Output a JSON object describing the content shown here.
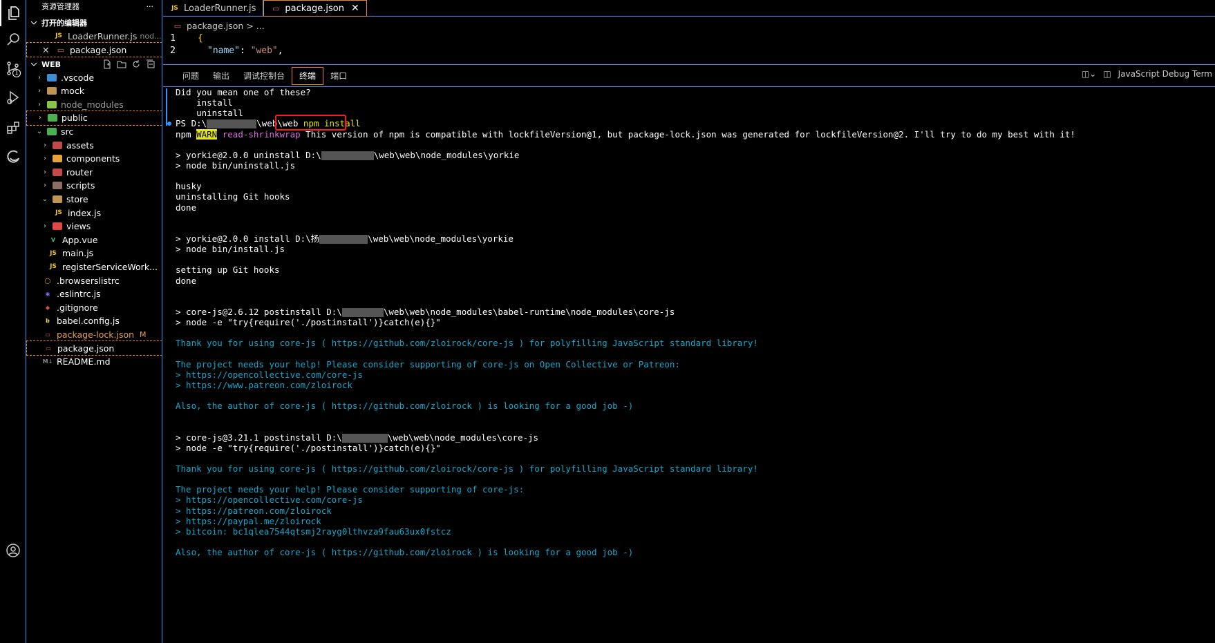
{
  "activity_bar": {
    "items": [
      {
        "name": "explorer-icon"
      },
      {
        "name": "search-icon"
      },
      {
        "name": "source-control-icon",
        "badge": "1"
      },
      {
        "name": "run-debug-icon"
      },
      {
        "name": "extensions-icon"
      },
      {
        "name": "edge-icon"
      },
      {
        "name": "account-icon"
      }
    ]
  },
  "sidebar": {
    "title": "资源管理器",
    "more": "···",
    "open_editors_label": "打开的编辑器",
    "open_editors": [
      {
        "label": "LoaderRunner.js",
        "desc": "nod..."
      },
      {
        "label": "package.json"
      }
    ],
    "workspace_label": "WEB",
    "tree": [
      {
        "label": ".vscode",
        "indent": 1,
        "kind": "folder",
        "color": "#3c8dd6",
        "open": false
      },
      {
        "label": "mock",
        "indent": 1,
        "kind": "folder",
        "color": "#c09553",
        "open": false
      },
      {
        "label": "node_modules",
        "indent": 1,
        "kind": "folder",
        "color": "#8bc34a",
        "open": false,
        "dim": true
      },
      {
        "label": "public",
        "indent": 1,
        "kind": "folder",
        "color": "#4caf50",
        "open": false,
        "selected": true
      },
      {
        "label": "src",
        "indent": 1,
        "kind": "folder",
        "color": "#4caf50",
        "open": true
      },
      {
        "label": "assets",
        "indent": 2,
        "kind": "folder",
        "color": "#c04a4a",
        "open": false
      },
      {
        "label": "components",
        "indent": 2,
        "kind": "folder",
        "color": "#e6a23c",
        "open": false
      },
      {
        "label": "router",
        "indent": 2,
        "kind": "folder",
        "color": "#c04a4a",
        "open": false
      },
      {
        "label": "scripts",
        "indent": 2,
        "kind": "folder",
        "color": "#8d6e63",
        "open": false
      },
      {
        "label": "store",
        "indent": 2,
        "kind": "folder",
        "color": "#c09553",
        "open": true
      },
      {
        "label": "index.js",
        "indent": 3,
        "kind": "js"
      },
      {
        "label": "views",
        "indent": 2,
        "kind": "folder",
        "color": "#e04848",
        "open": false
      },
      {
        "label": "App.vue",
        "indent": 2,
        "kind": "vue"
      },
      {
        "label": "main.js",
        "indent": 2,
        "kind": "js"
      },
      {
        "label": "registerServiceWork...",
        "indent": 2,
        "kind": "js"
      },
      {
        "label": ".browserslistrc",
        "indent": 1,
        "kind": "browserslist"
      },
      {
        "label": ".eslintrc.js",
        "indent": 1,
        "kind": "eslint"
      },
      {
        "label": ".gitignore",
        "indent": 1,
        "kind": "git"
      },
      {
        "label": "babel.config.js",
        "indent": 1,
        "kind": "babel"
      },
      {
        "label": "package-lock.json",
        "indent": 1,
        "kind": "json",
        "modified": "M"
      },
      {
        "label": "package.json",
        "indent": 1,
        "kind": "json",
        "selected": true
      },
      {
        "label": "README.md",
        "indent": 1,
        "kind": "md"
      }
    ]
  },
  "tabs": [
    {
      "label": "LoaderRunner.js",
      "kind": "js",
      "active": false
    },
    {
      "label": "package.json",
      "kind": "json",
      "active": true
    }
  ],
  "breadcrumb": {
    "file": "package.json",
    "sep": ">",
    "rest": "..."
  },
  "code": {
    "line1_no": "1",
    "line1": "{",
    "line2_no": "2",
    "line2_key": "\"name\"",
    "line2_colon": ": ",
    "line2_val": "\"web\"",
    "line2_end": ","
  },
  "panel": {
    "tabs": [
      "问题",
      "输出",
      "调试控制台",
      "终端",
      "端口"
    ],
    "active_tab": "终端",
    "right_label": "JavaScript Debug Term"
  },
  "terminal": {
    "lines": [
      "Did you mean one of these?",
      "    install",
      "    uninstall",
      "PS D:\\",
      "npm ",
      "",
      "> yorkie@2.0.0 uninstall D:\\",
      "> node bin/uninstall.js",
      "",
      "husky",
      "uninstalling Git hooks",
      "done",
      "",
      "",
      "> yorkie@2.0.0 install D:\\扬",
      "> node bin/install.js",
      "",
      "setting up Git hooks",
      "done",
      "",
      "",
      "> core-js@2.6.12 postinstall D:\\",
      "> node -e \"try{require('./postinstall')}catch(e){}\"",
      "",
      "Thank you for using core-js ( https://github.com/zloirock/core-js ) for polyfilling JavaScript standard library!",
      "",
      "The project needs your help! Please consider supporting of core-js on Open Collective or Patreon:",
      "> https://opencollective.com/core-js",
      "> https://www.patreon.com/zloirock",
      "",
      "Also, the author of core-js ( https://github.com/zloirock ) is looking for a good job -)",
      "",
      "",
      "> core-js@3.21.1 postinstall D:\\",
      "> node -e \"try{require('./postinstall')}catch(e){}\"",
      "",
      "Thank you for using core-js ( https://github.com/zloirock/core-js ) for polyfilling JavaScript standard library!",
      "",
      "The project needs your help! Please consider supporting of core-js:",
      "> https://opencollective.com/core-js",
      "> https://patreon.com/zloirock",
      "> https://paypal.me/zloirock",
      "> bitcoin: bc1qlea7544qtsmj2rayg0lthvza9fau63ux0fstcz",
      "",
      "Also, the author of core-js ( https://github.com/zloirock ) is looking for a good job -)"
    ],
    "ps_suffix": "\\web\\web",
    "ps_cmd": "npm install",
    "warn_word": "WARN",
    "warn_tag": "read-shrinkwrap",
    "warn_msg": " This version of npm is compatible with lockfileVersion@1, but package-lock.json was generated for lockfileVersion@2. I'll try to do my best with it!",
    "yorkie_un_suffix": "\\web\\web\\node_modules\\yorkie",
    "yorkie_in_suffix": "\\web\\web\\node_modules\\yorkie",
    "corejs2_suffix": "\\web\\web\\node_modules\\babel-runtime\\node_modules\\core-js",
    "corejs3_suffix": "\\web\\web\\node_modules\\core-js"
  }
}
